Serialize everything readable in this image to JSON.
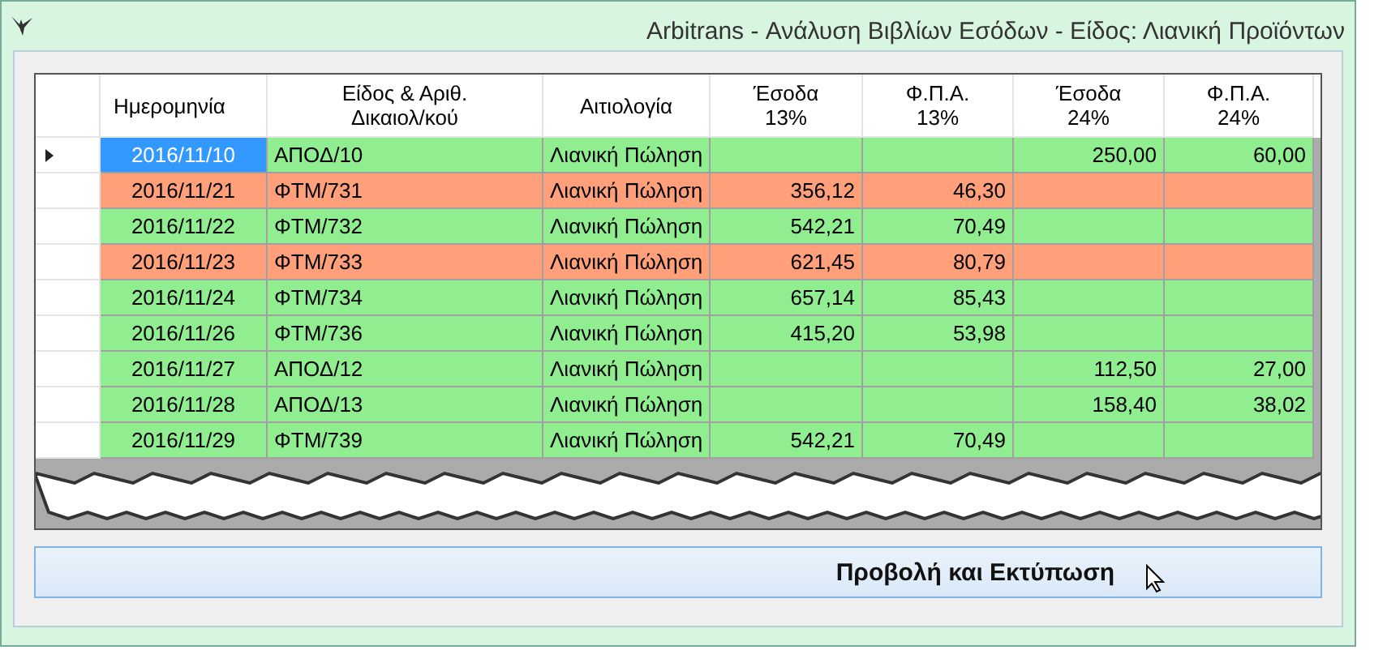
{
  "window": {
    "title": "Arbitrans - Ανάλυση Βιβλίων Εσόδων - Είδος: Λιανική Προϊόντων"
  },
  "table": {
    "columns": [
      {
        "label": "Ημερομηνία"
      },
      {
        "label": "Είδος & Αριθ.\nΔικαιολ/κού"
      },
      {
        "label": "Αιτιολογία"
      },
      {
        "label": "Έσοδα\n13%"
      },
      {
        "label": "Φ.Π.Α.\n13%"
      },
      {
        "label": "Έσοδα\n24%"
      },
      {
        "label": "Φ.Π.Α.\n24%"
      }
    ],
    "rows": [
      {
        "selected": true,
        "color": "#90ee90",
        "cells": [
          "2016/11/10",
          "ΑΠΟΔ/10",
          "Λιανική Πώληση",
          "",
          "",
          "250,00",
          "60,00"
        ]
      },
      {
        "selected": false,
        "color": "#ffa07a",
        "cells": [
          "2016/11/21",
          "ΦΤΜ/731",
          "Λιανική Πώληση",
          "356,12",
          "46,30",
          "",
          ""
        ]
      },
      {
        "selected": false,
        "color": "#90ee90",
        "cells": [
          "2016/11/22",
          "ΦΤΜ/732",
          "Λιανική Πώληση",
          "542,21",
          "70,49",
          "",
          ""
        ]
      },
      {
        "selected": false,
        "color": "#ffa07a",
        "cells": [
          "2016/11/23",
          "ΦΤΜ/733",
          "Λιανική Πώληση",
          "621,45",
          "80,79",
          "",
          ""
        ]
      },
      {
        "selected": false,
        "color": "#90ee90",
        "cells": [
          "2016/11/24",
          "ΦΤΜ/734",
          "Λιανική Πώληση",
          "657,14",
          "85,43",
          "",
          ""
        ]
      },
      {
        "selected": false,
        "color": "#90ee90",
        "cells": [
          "2016/11/26",
          "ΦΤΜ/736",
          "Λιανική Πώληση",
          "415,20",
          "53,98",
          "",
          ""
        ]
      },
      {
        "selected": false,
        "color": "#90ee90",
        "cells": [
          "2016/11/27",
          "ΑΠΟΔ/12",
          "Λιανική Πώληση",
          "",
          "",
          "112,50",
          "27,00"
        ]
      },
      {
        "selected": false,
        "color": "#90ee90",
        "cells": [
          "2016/11/28",
          "ΑΠΟΔ/13",
          "Λιανική Πώληση",
          "",
          "",
          "158,40",
          "38,02"
        ]
      },
      {
        "selected": false,
        "color": "#90ee90",
        "cells": [
          "2016/11/29",
          "ΦΤΜ/739",
          "Λιανική Πώληση",
          "542,21",
          "70,49",
          "",
          ""
        ]
      }
    ]
  },
  "buttons": [
    {
      "label": "Προβολή και Εκτύπωση"
    }
  ]
}
